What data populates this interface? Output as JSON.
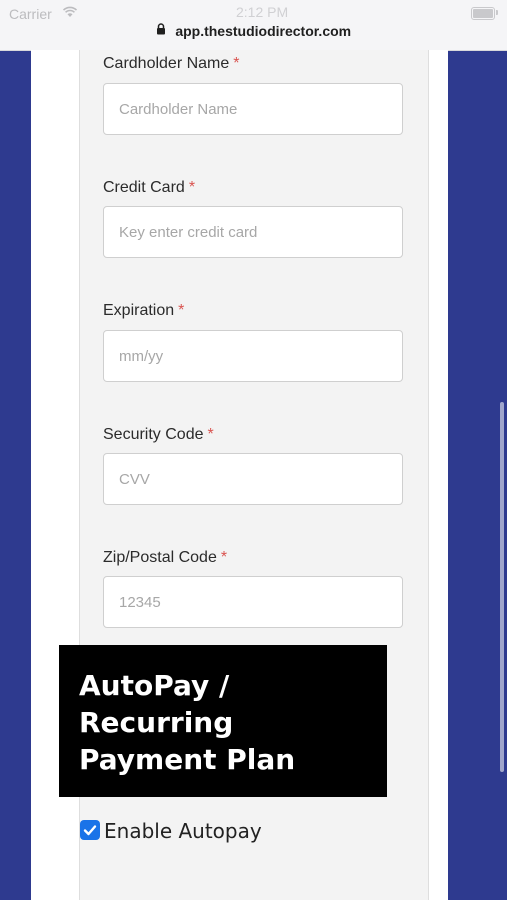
{
  "status_bar": {
    "carrier": "Carrier",
    "time": "2:12 PM"
  },
  "browser": {
    "url": "app.thestudiodirector.com"
  },
  "form": {
    "required_marker": "*",
    "fields": [
      {
        "label": "Cardholder Name",
        "placeholder": "Cardholder Name"
      },
      {
        "label": "Credit Card",
        "placeholder": "Key enter credit card"
      },
      {
        "label": "Expiration",
        "placeholder": "mm/yy"
      },
      {
        "label": "Security Code",
        "placeholder": "CVV"
      },
      {
        "label": "Zip/Postal Code",
        "placeholder": "12345"
      }
    ]
  },
  "autopay": {
    "banner_lines": [
      "AutoPay /",
      "Recurring",
      "Payment Plan"
    ],
    "checkbox_label": "Enable Autopay",
    "checked": true
  },
  "colors": {
    "page_bg": "#2e3a8f",
    "accent": "#1a73e8",
    "required": "#d9534f"
  }
}
